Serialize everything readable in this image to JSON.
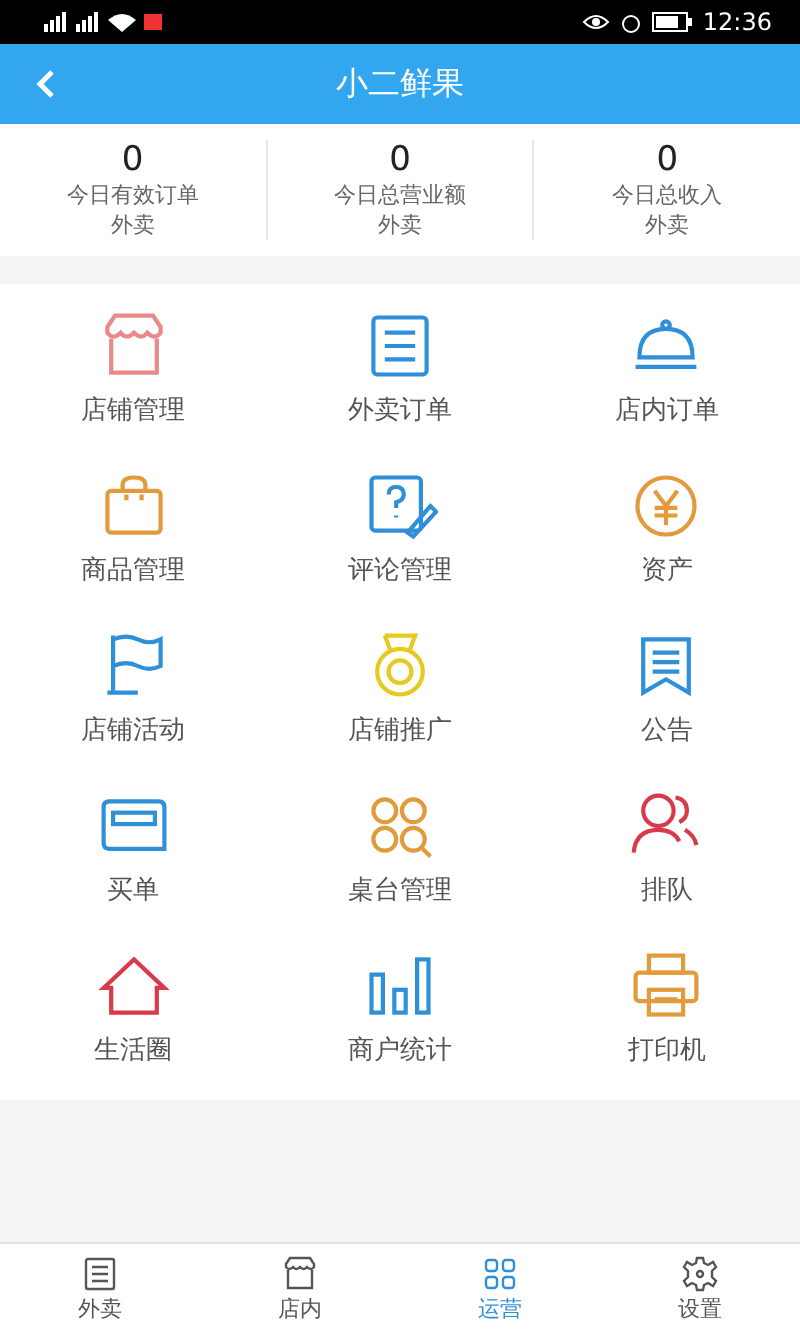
{
  "status_bar": {
    "time": "12:36"
  },
  "header": {
    "title": "小二鲜果"
  },
  "stats": [
    {
      "value": "0",
      "label": "今日有效订单",
      "sub": "外卖"
    },
    {
      "value": "0",
      "label": "今日总营业额",
      "sub": "外卖"
    },
    {
      "value": "0",
      "label": "今日总收入",
      "sub": "外卖"
    }
  ],
  "grid": [
    {
      "kind": "store",
      "label": "店铺管理"
    },
    {
      "kind": "list",
      "label": "外卖订单"
    },
    {
      "kind": "cloche",
      "label": "店内订单"
    },
    {
      "kind": "bag",
      "label": "商品管理"
    },
    {
      "kind": "review",
      "label": "评论管理"
    },
    {
      "kind": "yen",
      "label": "资产"
    },
    {
      "kind": "flag",
      "label": "店铺活动"
    },
    {
      "kind": "medal",
      "label": "店铺推广"
    },
    {
      "kind": "notice",
      "label": "公告"
    },
    {
      "kind": "card",
      "label": "买单"
    },
    {
      "kind": "tables",
      "label": "桌台管理"
    },
    {
      "kind": "queue",
      "label": "排队"
    },
    {
      "kind": "house",
      "label": "生活圈"
    },
    {
      "kind": "bars",
      "label": "商户统计"
    },
    {
      "kind": "printer",
      "label": "打印机"
    }
  ],
  "tabs": [
    {
      "kind": "list",
      "label": "外卖",
      "selected": false
    },
    {
      "kind": "store",
      "label": "店内",
      "selected": false
    },
    {
      "kind": "grid",
      "label": "运营",
      "selected": true
    },
    {
      "kind": "gear",
      "label": "设置",
      "selected": false
    }
  ]
}
